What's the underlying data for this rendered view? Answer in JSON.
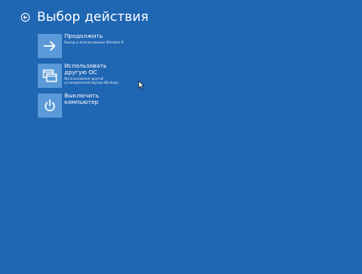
{
  "header": {
    "title": "Выбор действия"
  },
  "options": [
    {
      "icon": "arrow-right-icon",
      "label": "Продолжить",
      "desc": "Выход и использование Windows 8"
    },
    {
      "icon": "windows-icon",
      "label": "Использовать\nдругую ОС",
      "desc": "Использование другой\nустановленной версии Windows"
    },
    {
      "icon": "power-icon",
      "label": "Выключить\nкомпьютер",
      "desc": ""
    }
  ],
  "colors": {
    "background": "#1f66b3",
    "tile": "#5b9ad9",
    "text": "#ffffff"
  }
}
